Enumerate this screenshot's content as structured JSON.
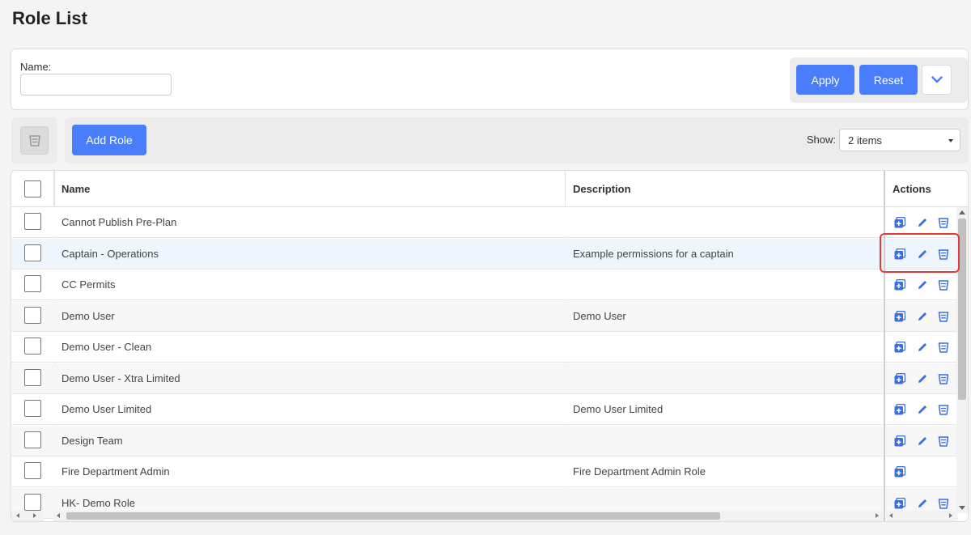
{
  "page": {
    "title": "Role List"
  },
  "filter": {
    "name_label": "Name:",
    "name_value": "",
    "apply_label": "Apply",
    "reset_label": "Reset",
    "expand_icon": "chevron-down-icon"
  },
  "toolbar": {
    "add_role_label": "Add Role",
    "show_label": "Show:",
    "show_value": "2 items",
    "bulk_delete_icon": "trash-icon"
  },
  "table": {
    "columns": {
      "name": "Name",
      "description": "Description",
      "actions": "Actions"
    },
    "rows": [
      {
        "name": "Cannot Publish Pre-Plan",
        "description": "",
        "actions": [
          "copy",
          "edit",
          "delete"
        ]
      },
      {
        "name": "Captain - Operations",
        "description": "Example permissions for a captain",
        "actions": [
          "copy",
          "edit",
          "delete"
        ]
      },
      {
        "name": "CC Permits",
        "description": "",
        "actions": [
          "copy",
          "edit",
          "delete"
        ]
      },
      {
        "name": "Demo User",
        "description": "Demo User",
        "actions": [
          "copy",
          "edit",
          "delete"
        ]
      },
      {
        "name": "Demo User - Clean",
        "description": "",
        "actions": [
          "copy",
          "edit",
          "delete"
        ]
      },
      {
        "name": "Demo User - Xtra Limited",
        "description": "",
        "actions": [
          "copy",
          "edit",
          "delete"
        ]
      },
      {
        "name": "Demo User Limited",
        "description": "Demo User Limited",
        "actions": [
          "copy",
          "edit",
          "delete"
        ]
      },
      {
        "name": "Design Team",
        "description": "",
        "actions": [
          "copy",
          "edit",
          "delete"
        ]
      },
      {
        "name": "Fire Department Admin",
        "description": "Fire Department Admin Role",
        "actions": [
          "copy"
        ]
      },
      {
        "name": "HK- Demo Role",
        "description": "",
        "actions": [
          "copy",
          "edit",
          "delete"
        ]
      }
    ]
  },
  "colors": {
    "accent": "#4a7dfc",
    "highlight_row": "#eef5fc",
    "annotation": "#e03a3a"
  }
}
